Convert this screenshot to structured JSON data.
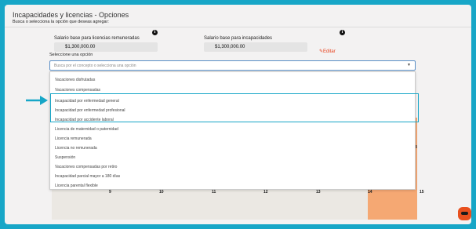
{
  "header": {
    "title": "Incapacidades y licencias - Opciones",
    "subtitle": "Busca o selecciona la opción que deseas agregar:"
  },
  "salary_remunerated": {
    "label": "Salario base para licencias remuneradas",
    "value": "$1,300,000.00"
  },
  "salary_incapacity": {
    "label": "Salario base para incapacidades",
    "value": "$1,300,000.00",
    "edit_label": "Editar"
  },
  "select": {
    "label": "Seleccione una opción",
    "placeholder": "Busca por el concepto o selecciona una opción"
  },
  "options": [
    "Vacaciones disfrutadas",
    "Vacaciones compensadas",
    "Incapacidad por enfermedad general",
    "Incapacidad por enfermedad profesional",
    "Incapacidad por accidente laboral",
    "Licencia de maternidad o paternidad",
    "Licencia remunerada",
    "Licencia no remunerada",
    "Suspensión",
    "Vacaciones compensadas por retiro",
    "Incapacidad parcial mayor a 180 días",
    "Licencia parental flexible"
  ],
  "calendar": {
    "day_numbers": [
      "9",
      "10",
      "11",
      "12",
      "13",
      "14",
      "15"
    ],
    "side_number": "8"
  },
  "colors": {
    "frame": "#17a6c7",
    "highlight_border": "#17a6c7",
    "edit": "#e8401c",
    "calendar_highlight": "#f5a873"
  }
}
